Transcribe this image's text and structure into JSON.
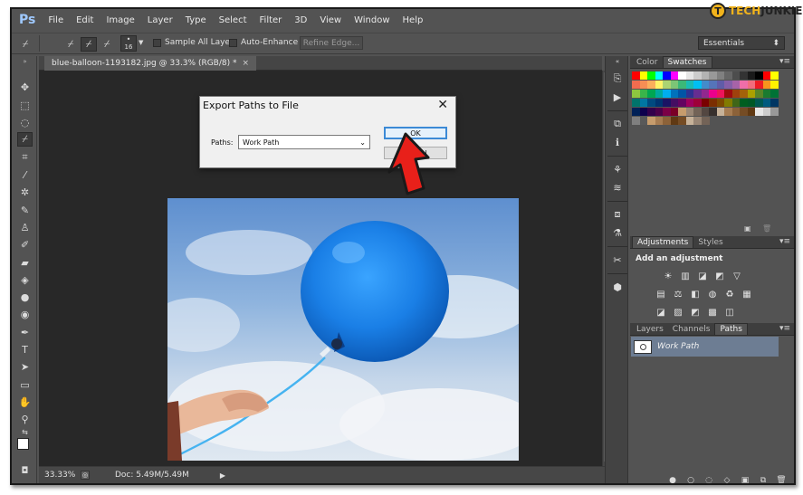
{
  "app": {
    "logo": "Ps",
    "menu": [
      "File",
      "Edit",
      "Image",
      "Layer",
      "Type",
      "Select",
      "Filter",
      "3D",
      "View",
      "Window",
      "Help"
    ]
  },
  "watermark": {
    "badge": "T",
    "brand_prefix": "TECH",
    "brand_suffix": "JUNKIE"
  },
  "options_bar": {
    "brush_size": "16",
    "sample_all_layers": "Sample All Layers",
    "auto_enhance": "Auto-Enhance",
    "refine_edge": "Refine Edge...",
    "workspace": "Essentials"
  },
  "document": {
    "tab_title": "blue-balloon-1193182.jpg @ 33.3% (RGB/8) *",
    "tab_close": "×"
  },
  "status_bar": {
    "zoom": "33.33%",
    "doc_info": "Doc: 5.49M/5.49M"
  },
  "dialog": {
    "title": "Export Paths to File",
    "close": "✕",
    "paths_label": "Paths:",
    "paths_value": "Work Path",
    "ok_label": "OK",
    "cancel_label": "cel"
  },
  "panels": {
    "color_tab": "Color",
    "swatches_tab": "Swatches",
    "adjustments_tab": "Adjustments",
    "styles_tab": "Styles",
    "add_adjustment": "Add an adjustment",
    "layers_tab": "Layers",
    "channels_tab": "Channels",
    "paths_tab": "Paths",
    "work_path": "Work Path"
  },
  "colors": {
    "ui_bg": "#535353",
    "canvas_bg": "#282828",
    "dialog_bg": "#f0f0f0",
    "ok_border": "#3c8ad6",
    "arrow_red": "#e8201a",
    "balloon_blue": "#1a7fe6",
    "path_row": "#6d7d93"
  },
  "swatch_rows": [
    [
      "#ff0000",
      "#ffff00",
      "#00ff00",
      "#00ffff",
      "#0000ff",
      "#ff00ff",
      "#ffffff",
      "#e6e6e6",
      "#cccccc",
      "#b3b3b3",
      "#999999",
      "#808080",
      "#666666",
      "#4d4d4d",
      "#333333",
      "#1a1a1a",
      "#000000",
      "#ff0000",
      "#ffff00"
    ],
    [
      "#f26c4f",
      "#f68e55",
      "#fbaf5c",
      "#fff467",
      "#acd372",
      "#7cc576",
      "#3bb878",
      "#1abbb4",
      "#00bff3",
      "#438ccb",
      "#5574b9",
      "#605ca8",
      "#855fa8",
      "#a763a8",
      "#f06ea9",
      "#f26d7d",
      "#ed1c24",
      "#f7941d",
      "#fff200"
    ],
    [
      "#8dc73f",
      "#39b54a",
      "#00a651",
      "#00a99d",
      "#00aeef",
      "#0072bc",
      "#0054a6",
      "#2e3192",
      "#662d91",
      "#92278f",
      "#ec008c",
      "#ed145b",
      "#9e0b0f",
      "#a0410d",
      "#a3620a",
      "#aba000",
      "#598527",
      "#1a7b30",
      "#007236"
    ],
    [
      "#00746b",
      "#0076a3",
      "#004a80",
      "#003471",
      "#1b1464",
      "#440e62",
      "#630460",
      "#9e005d",
      "#9e0039",
      "#790000",
      "#7b2e00",
      "#7d4900",
      "#827b00",
      "#406618",
      "#005e20",
      "#005826",
      "#005952",
      "#005b7f",
      "#003663"
    ],
    [
      "#002157",
      "#0d004c",
      "#32004b",
      "#4b0049",
      "#7b0046",
      "#7a0026",
      "#c69c6d",
      "#998675",
      "#736357",
      "#534741",
      "#37302d",
      "#c7b299",
      "#a67c52",
      "#8c6239",
      "#754c24",
      "#603913",
      "#e6e6e6",
      "#cccccc",
      "#999999"
    ],
    [
      "#7f7f7f",
      "#595959",
      "#c69c6d",
      "#a67c52",
      "#8c6239",
      "#603913",
      "#754c24",
      "#c7b299",
      "#998675",
      "#736357"
    ]
  ]
}
